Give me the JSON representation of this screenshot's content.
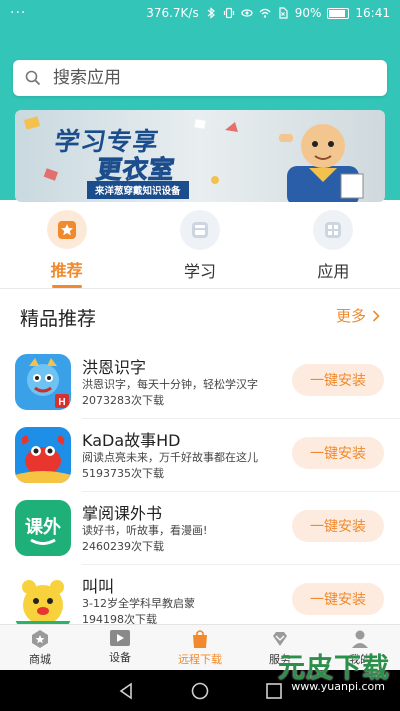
{
  "status_bar": {
    "left": "···",
    "speed": "376.7K/s",
    "battery": "90%",
    "time": "16:41"
  },
  "search": {
    "placeholder": "搜索应用"
  },
  "banner": {
    "line1": "学习专享",
    "line2": "更衣室",
    "subtitle": "来洋葱穿戴知识设备"
  },
  "tabs": [
    {
      "label": "推荐",
      "icon": "star-icon",
      "active": true
    },
    {
      "label": "学习",
      "icon": "book-icon",
      "active": false
    },
    {
      "label": "应用",
      "icon": "grid-icon",
      "active": false
    }
  ],
  "section": {
    "title": "精品推荐",
    "more": "更多"
  },
  "apps": [
    {
      "name": "洪恩识字",
      "desc": "洪恩识字，每天十分钟，轻松学汉字",
      "downloads": "2073283次下载",
      "button": "一键安装",
      "icon": "hongen-app-icon"
    },
    {
      "name": "KaDa故事HD",
      "desc": "阅读点亮未来，万千好故事都在这儿",
      "downloads": "5193735次下载",
      "button": "一键安装",
      "icon": "kada-app-icon"
    },
    {
      "name": "掌阅课外书",
      "desc": "读好书，听故事，看漫画!",
      "downloads": "2460239次下载",
      "button": "一键安装",
      "icon": "zhangyue-app-icon"
    },
    {
      "name": "叫叫",
      "desc": "3-12岁全学科早教启蒙",
      "downloads": "194198次下载",
      "button": "一键安装",
      "icon": "jiaojiao-app-icon"
    }
  ],
  "bottom_nav": [
    {
      "label": "商城",
      "icon": "store-icon",
      "active": false
    },
    {
      "label": "设备",
      "icon": "device-icon",
      "active": false
    },
    {
      "label": "远程下载",
      "icon": "bag-icon",
      "active": true
    },
    {
      "label": "服务",
      "icon": "diamond-icon",
      "active": false
    },
    {
      "label": "我的",
      "icon": "user-icon",
      "active": false
    }
  ],
  "watermark": {
    "text": "元皮下载",
    "url": "www.yuanpi.com"
  },
  "colors": {
    "header": "#33c5b8",
    "accent": "#f08a2c",
    "install_bg": "#fdebe0"
  }
}
